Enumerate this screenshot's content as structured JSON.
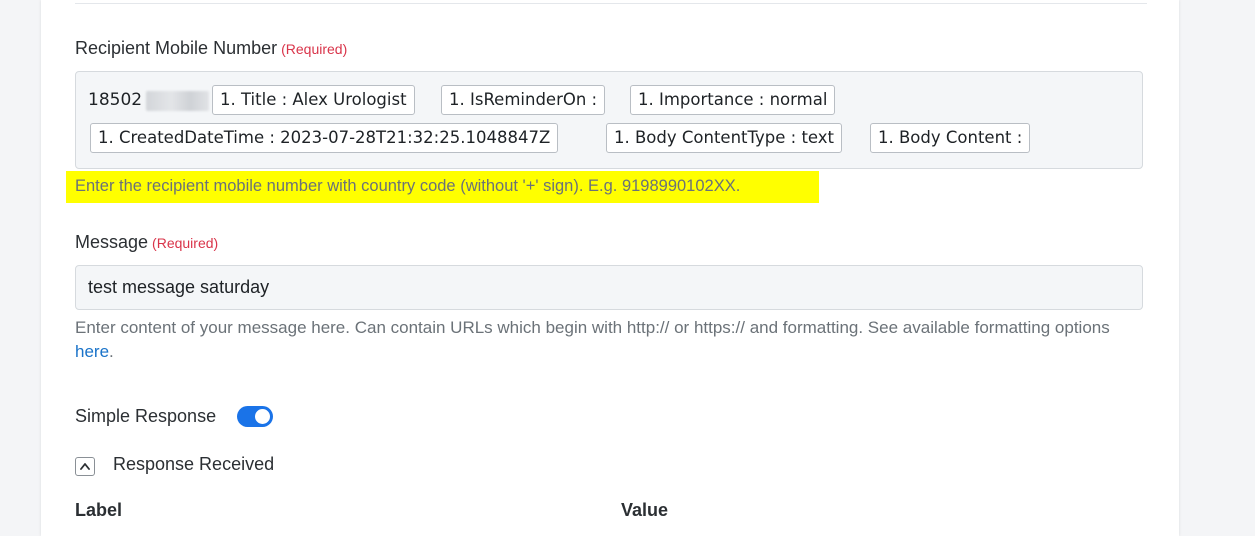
{
  "recipient": {
    "label": "Recipient Mobile Number",
    "required": "(Required)",
    "value_prefix": "18502",
    "tokens": [
      "1. Title : Alex Urologist",
      "1. IsReminderOn :",
      "1. Importance : normal",
      "1. CreatedDateTime : 2023-07-28T21:32:25.1048847Z",
      "1. Body ContentType : text",
      "1. Body Content :"
    ],
    "hint": "Enter the recipient mobile number with country code (without '+' sign). E.g. 9198990102XX.",
    "hint_highlight_color": "#ffff00"
  },
  "message": {
    "label": "Message",
    "required": "(Required)",
    "value": "test message saturday",
    "help_text": "Enter content of your message here. Can contain URLs which begin with http:// or https:// and formatting. See available formatting options",
    "help_link": "here",
    "help_end": "."
  },
  "simple_response": {
    "label": "Simple Response",
    "enabled": true,
    "toggle_color": "#1a73e8"
  },
  "response_received": {
    "label": "Response Received",
    "expand_icon": "chevron-up-icon"
  },
  "table": {
    "columns": [
      "Label",
      "Value"
    ]
  }
}
